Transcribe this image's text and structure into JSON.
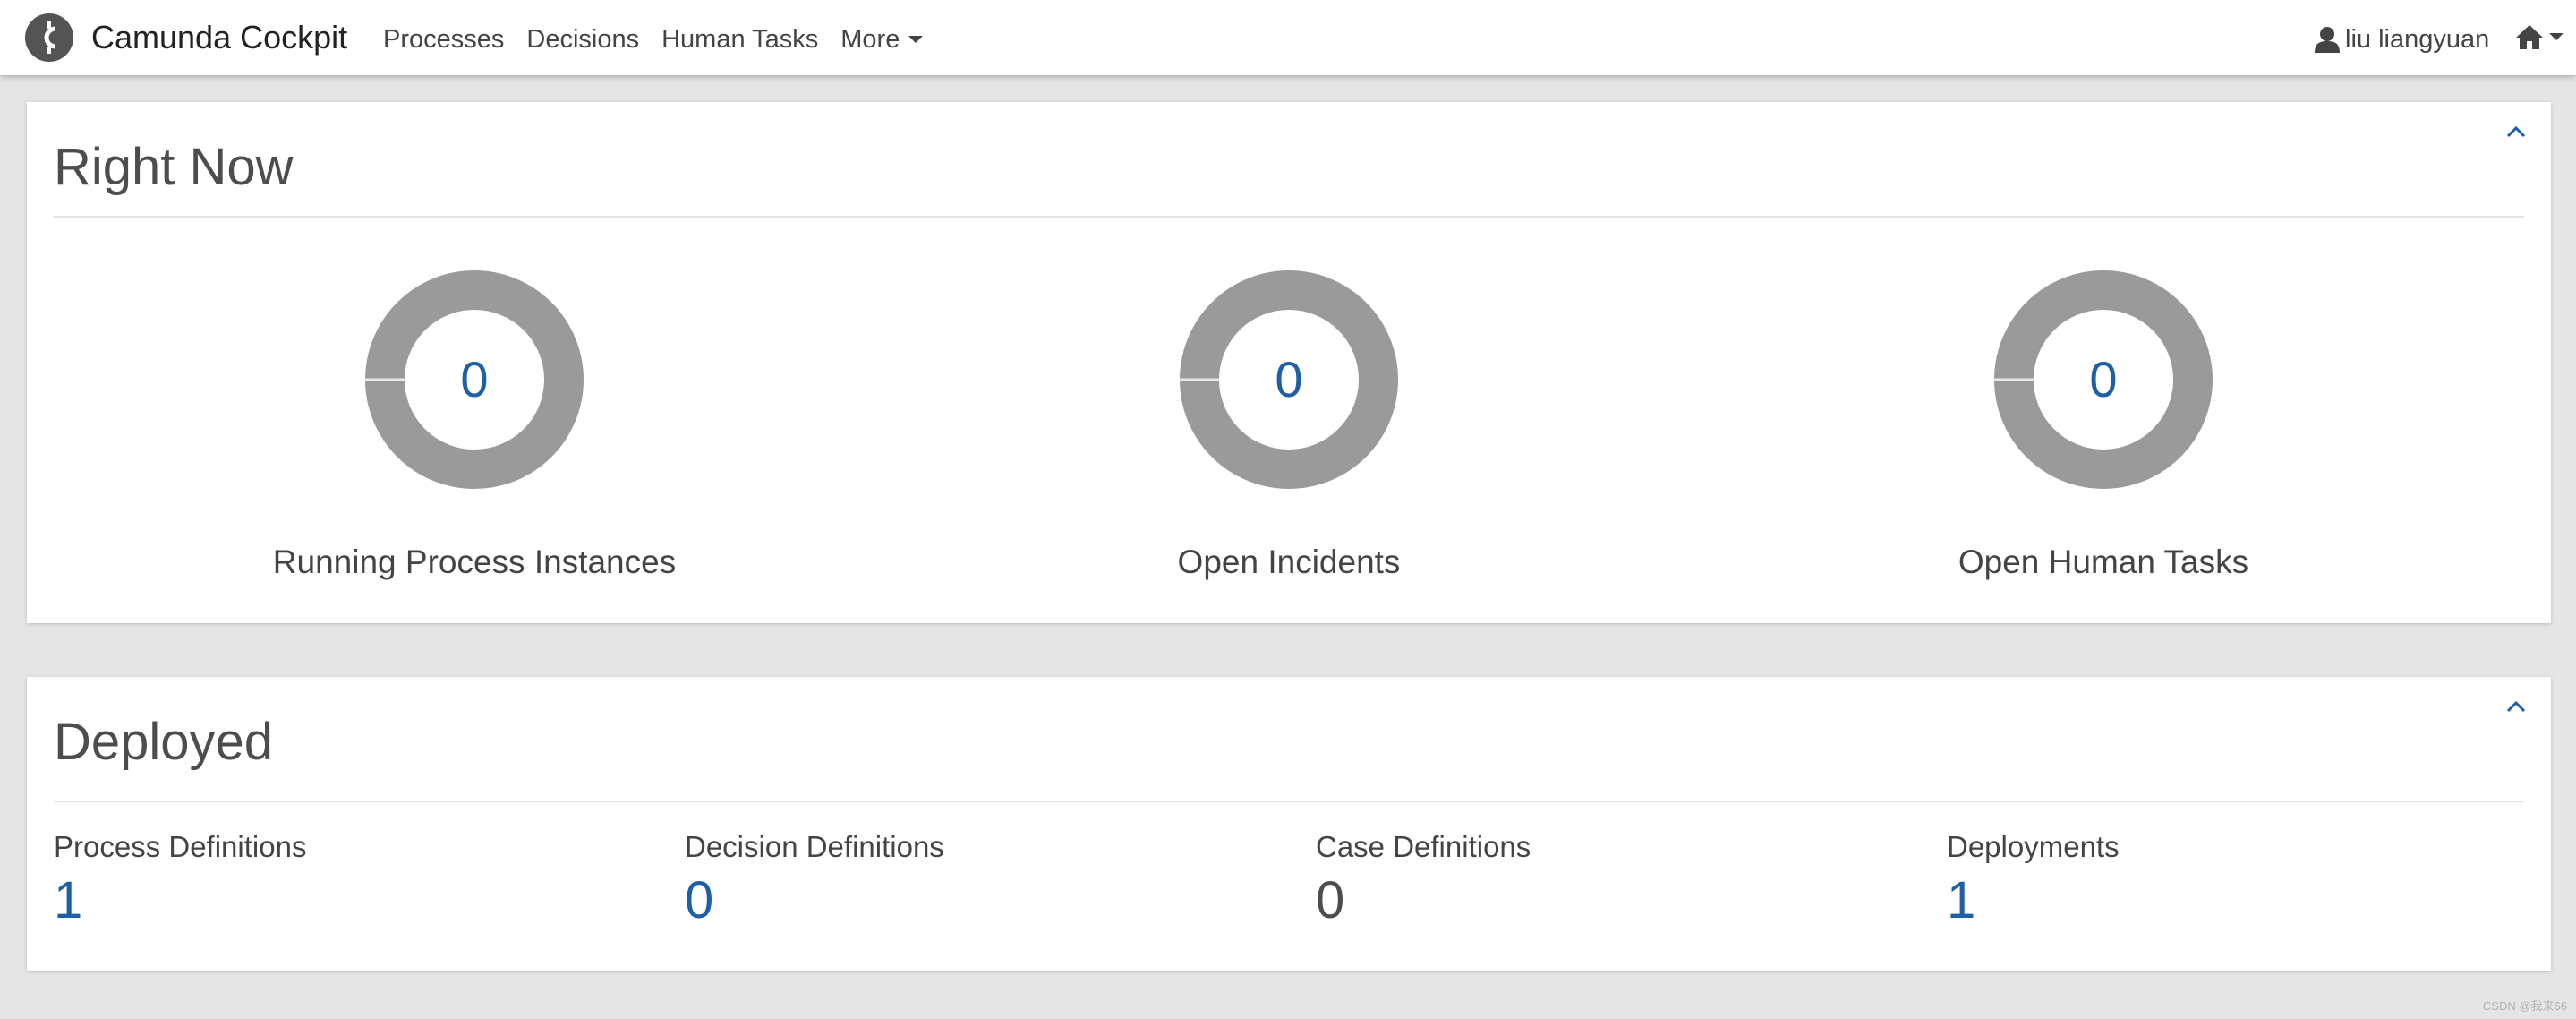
{
  "header": {
    "brand": "Camunda Cockpit",
    "logo_letter": "C",
    "nav": [
      "Processes",
      "Decisions",
      "Human Tasks",
      "More"
    ],
    "user_name": "liu liangyuan"
  },
  "right_now": {
    "title": "Right Now",
    "stats": [
      {
        "value": "0",
        "label": "Running Process Instances"
      },
      {
        "value": "0",
        "label": "Open Incidents"
      },
      {
        "value": "0",
        "label": "Open Human Tasks"
      }
    ]
  },
  "deployed": {
    "title": "Deployed",
    "items": [
      {
        "label": "Process Definitions",
        "value": "1"
      },
      {
        "label": "Decision Definitions",
        "value": "0"
      },
      {
        "label": "Case Definitions",
        "value": "0"
      },
      {
        "label": "Deployments",
        "value": "1"
      }
    ]
  },
  "watermark": "CSDN @我来66",
  "colors": {
    "accent": "#1f5fa8",
    "donut": "#9a9a9a",
    "background": "#e5e5e5"
  }
}
